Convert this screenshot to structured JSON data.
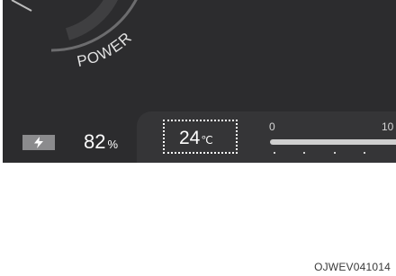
{
  "gauge": {
    "mode_label": "POWER"
  },
  "status": {
    "battery_icon": "battery-charge-icon",
    "battery_value": "82",
    "battery_unit": "%"
  },
  "climate": {
    "temperature_value": "24",
    "temperature_unit": "℃"
  },
  "scale": {
    "min_label": "0",
    "max_label": "10"
  },
  "figure": {
    "caption": "OJWEV041014"
  },
  "colors": {
    "cluster_background": "#2c2c2e",
    "panel_background": "#353537",
    "text": "#ffffff",
    "highlight_border": "#ffffff"
  }
}
